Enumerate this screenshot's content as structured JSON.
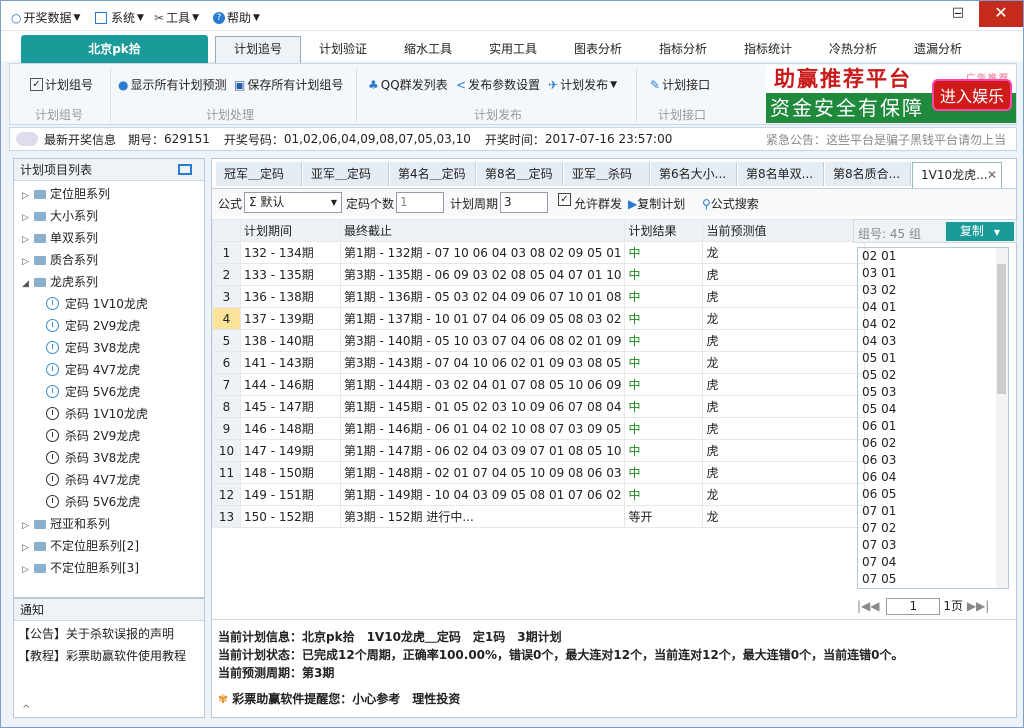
{
  "menu": {
    "items": [
      {
        "label": "开奖数据"
      },
      {
        "label": "系统"
      },
      {
        "label": "工具"
      },
      {
        "label": "帮助"
      }
    ]
  },
  "window": {
    "minimize": "–",
    "maximize": "□",
    "close": "✕"
  },
  "brand_tab": "北京pk拾",
  "nav_tabs": [
    {
      "label": "计划追号"
    },
    {
      "label": "计划验证"
    },
    {
      "label": "缩水工具"
    },
    {
      "label": "实用工具"
    },
    {
      "label": "图表分析"
    },
    {
      "label": "指标分析"
    },
    {
      "label": "指标统计"
    },
    {
      "label": "冷热分析"
    },
    {
      "label": "遗漏分析"
    }
  ],
  "ribbon": {
    "group_plan": {
      "button": "计划组号",
      "label": "计划组号"
    },
    "group_process": {
      "show_all": "显示所有计划预测",
      "save_all": "保存所有计划组号",
      "label": "计划处理"
    },
    "group_publish": {
      "qq": "QQ群发列表",
      "params": "发布参数设置",
      "publish": "计划发布",
      "label": "计划发布"
    },
    "group_api": {
      "button": "计划接口",
      "label": "计划接口"
    }
  },
  "ad": {
    "line1": "助赢推荐平台",
    "line1b": "广告推荐",
    "line2": "资金安全有保障",
    "btn": "进入娱乐"
  },
  "infobar": {
    "title": "最新开奖信息",
    "period_label": "期号：",
    "period": "629151",
    "draw_label": "开奖号码：",
    "draw": "01,02,06,04,09,08,07,05,03,10",
    "time_label": "开奖时间：",
    "time": "2017-07-16 23:57:00",
    "notice": "紧急公告：这些平台是骗子黑钱平台请勿上当"
  },
  "left": {
    "title": "计划项目列表",
    "tree": [
      {
        "label": "定位胆系列",
        "type": "folder"
      },
      {
        "label": "大小系列",
        "type": "folder"
      },
      {
        "label": "单双系列",
        "type": "folder"
      },
      {
        "label": "质合系列",
        "type": "folder"
      },
      {
        "label": "龙虎系列",
        "type": "folder",
        "open": true
      },
      {
        "label": "定码 1V10龙虎",
        "type": "blue"
      },
      {
        "label": "定码 2V9龙虎",
        "type": "blue"
      },
      {
        "label": "定码 3V8龙虎",
        "type": "blue"
      },
      {
        "label": "定码 4V7龙虎",
        "type": "blue"
      },
      {
        "label": "定码 5V6龙虎",
        "type": "blue"
      },
      {
        "label": "杀码 1V10龙虎",
        "type": "dark"
      },
      {
        "label": "杀码 2V9龙虎",
        "type": "dark"
      },
      {
        "label": "杀码 3V8龙虎",
        "type": "dark"
      },
      {
        "label": "杀码 4V7龙虎",
        "type": "dark"
      },
      {
        "label": "杀码 5V6龙虎",
        "type": "dark"
      },
      {
        "label": "冠亚和系列",
        "type": "folder"
      },
      {
        "label": "不定位胆系列[2]",
        "type": "folder"
      },
      {
        "label": "不定位胆系列[3]",
        "type": "folder"
      }
    ]
  },
  "notice": {
    "title": "通知",
    "items": [
      "【公告】关于杀软误报的声明",
      "【教程】彩票助赢软件使用教程"
    ]
  },
  "doc_tabs": [
    {
      "label": "冠军＿定码"
    },
    {
      "label": "亚军＿定码"
    },
    {
      "label": "第4名＿定码"
    },
    {
      "label": "第8名＿定码"
    },
    {
      "label": "亚军＿杀码"
    },
    {
      "label": "第6名大小..."
    },
    {
      "label": "第8名单双..."
    },
    {
      "label": "第8名质合..."
    },
    {
      "label": "1V10龙虎..."
    }
  ],
  "toolbar": {
    "formula_label": "公式",
    "formula_value": "Σ 默认",
    "count_label": "定码个数",
    "count": "1",
    "cycle_label": "计划周期",
    "cycle": "3",
    "allow_group": "允许群发",
    "copy_plan": "复制计划",
    "search": "公式搜索"
  },
  "table": {
    "headers": [
      "计划期间",
      "最终截止",
      "计划结果",
      "当前预测值"
    ],
    "rows": [
      [
        "1",
        "132 - 134期",
        "第1期 - 132期 - 07 10 06 04 03 08 02 09 05 01",
        "中",
        "龙"
      ],
      [
        "2",
        "133 - 135期",
        "第3期 - 135期 - 06 09 03 02 08 05 04 07 01 10",
        "中",
        "虎"
      ],
      [
        "3",
        "136 - 138期",
        "第1期 - 136期 - 05 03 02 04 09 06 07 10 01 08",
        "中",
        "虎"
      ],
      [
        "4",
        "137 - 139期",
        "第1期 - 137期 - 10 01 07 04 06 09 05 08 03 02",
        "中",
        "龙"
      ],
      [
        "5",
        "138 - 140期",
        "第3期 - 140期 - 05 10 03 07 04 06 08 02 01 09",
        "中",
        "虎"
      ],
      [
        "6",
        "141 - 143期",
        "第3期 - 143期 - 07 04 10 06 02 01 09 03 08 05",
        "中",
        "龙"
      ],
      [
        "7",
        "144 - 146期",
        "第1期 - 144期 - 03 02 04 01 07 08 05 10 06 09",
        "中",
        "虎"
      ],
      [
        "8",
        "145 - 147期",
        "第1期 - 145期 - 01 05 02 03 10 09 06 07 08 04",
        "中",
        "虎"
      ],
      [
        "9",
        "146 - 148期",
        "第1期 - 146期 - 06 01 04 02 10 08 07 03 09 05",
        "中",
        "虎"
      ],
      [
        "10",
        "147 - 149期",
        "第1期 - 147期 - 06 02 04 03 09 07 01 08 05 10",
        "中",
        "虎"
      ],
      [
        "11",
        "148 - 150期",
        "第1期 - 148期 - 02 01 07 04 05 10 09 08 06 03",
        "中",
        "虎"
      ],
      [
        "12",
        "149 - 151期",
        "第1期 - 149期 - 10 04 03 09 05 08 01 07 06 02",
        "中",
        "龙"
      ],
      [
        "13",
        "150 - 152期",
        "第3期 - 152期 进行中...",
        "等开",
        "龙"
      ]
    ]
  },
  "group_list": {
    "count_label": "组号: 45 组",
    "copy": "复制",
    "items": [
      "02 01",
      "03 01",
      "03 02",
      "04 01",
      "04 02",
      "04 03",
      "05 01",
      "05 02",
      "05 03",
      "05 04",
      "06 01",
      "06 02",
      "06 03",
      "06 04",
      "06 05",
      "07 01",
      "07 02",
      "07 03",
      "07 04",
      "07 05"
    ],
    "page": "1",
    "page_total": "1页"
  },
  "footer": {
    "info_label": "当前计划信息：",
    "info": "北京pk拾　1V10龙虎＿定码　定1码　3期计划",
    "state_label": "当前计划状态：",
    "state": "已完成12个周期，正确率100.00%，错误0个，最大连对12个，当前连对12个，最大连错0个，当前连错0个。",
    "cycle_label": "当前预测周期：",
    "cycle": "第3期",
    "tip": "彩票助赢软件提醒您：小心参考　理性投资"
  }
}
